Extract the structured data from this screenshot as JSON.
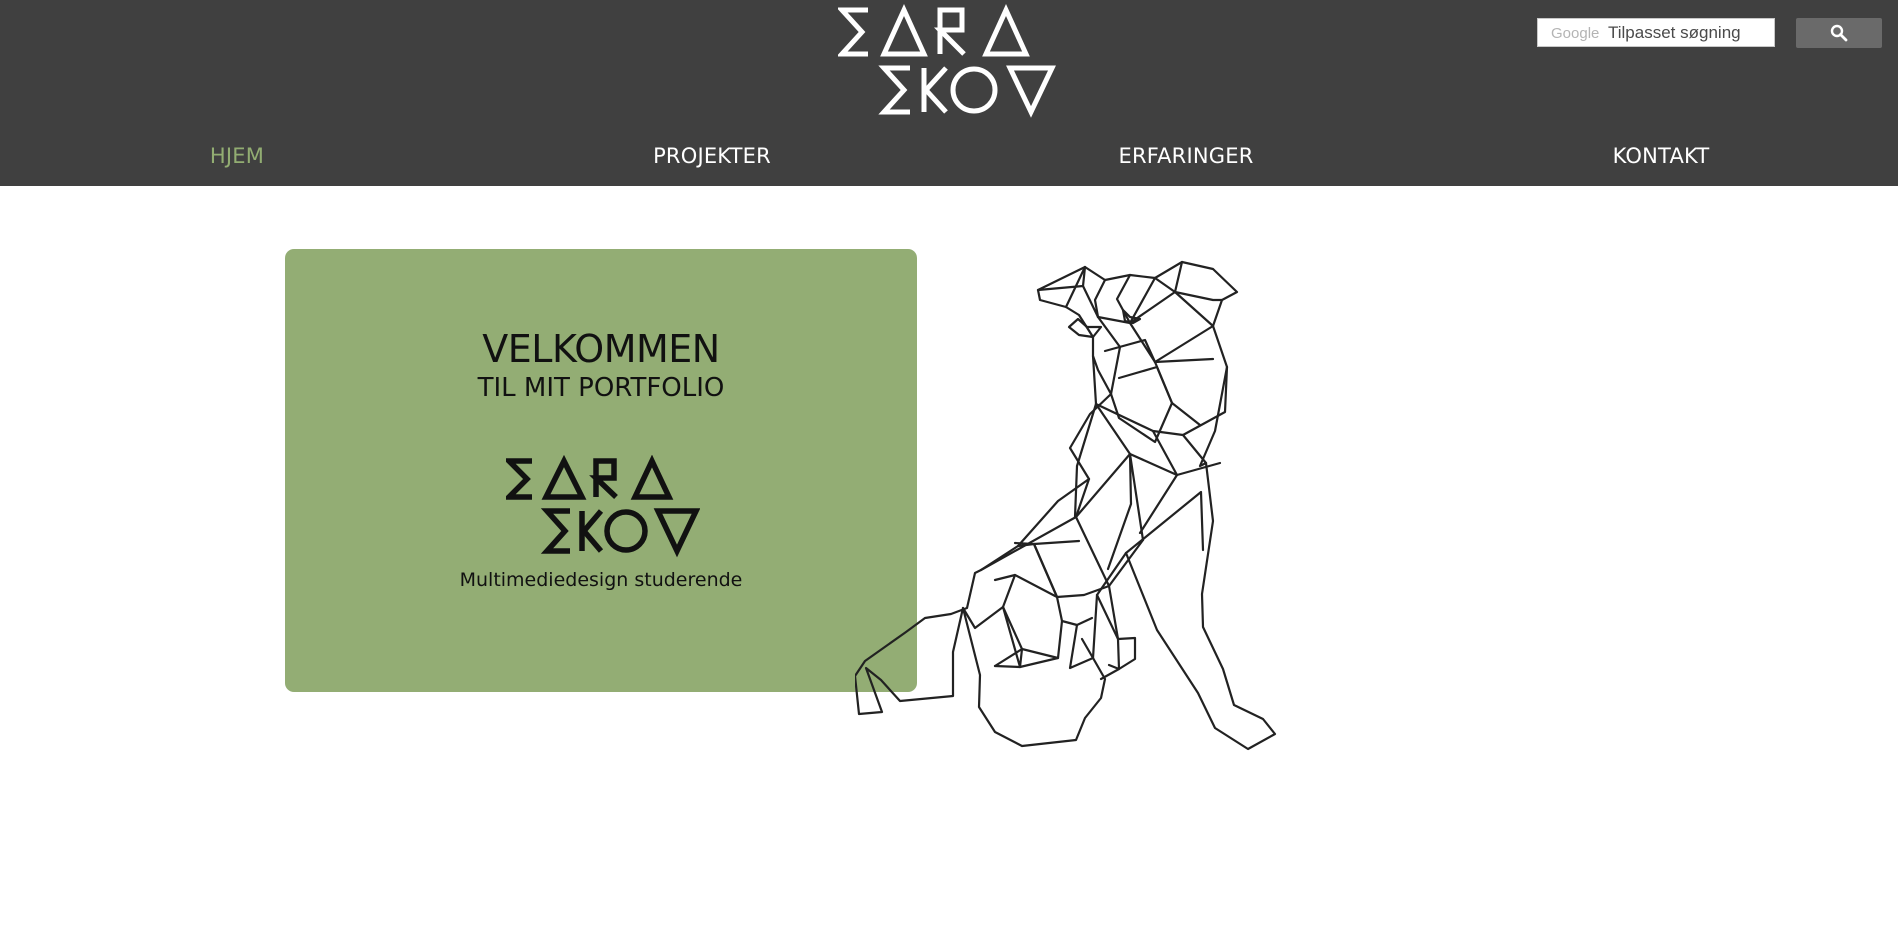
{
  "header": {
    "logo_text": [
      "SARA",
      "SKOV"
    ],
    "search": {
      "provider": "Google",
      "placeholder": "Tilpasset søgning",
      "button_icon": "search-icon"
    },
    "nav": [
      {
        "label": "HJEM",
        "active": true
      },
      {
        "label": "PROJEKTER",
        "active": false
      },
      {
        "label": "ERFARINGER",
        "active": false
      },
      {
        "label": "KONTAKT",
        "active": false
      }
    ]
  },
  "hero": {
    "title": "VELKOMMEN",
    "subtitle": "TIL MIT PORTFOLIO",
    "logo_text": [
      "SARA",
      "SKOV"
    ],
    "tagline": "Multimediedesign studerende"
  },
  "illustration": {
    "icon": "geometric-dog-illustration"
  },
  "colors": {
    "header_bg": "#404040",
    "accent_green": "#93ad74",
    "active_nav": "#92ad72",
    "page_bg": "#ffffff"
  }
}
